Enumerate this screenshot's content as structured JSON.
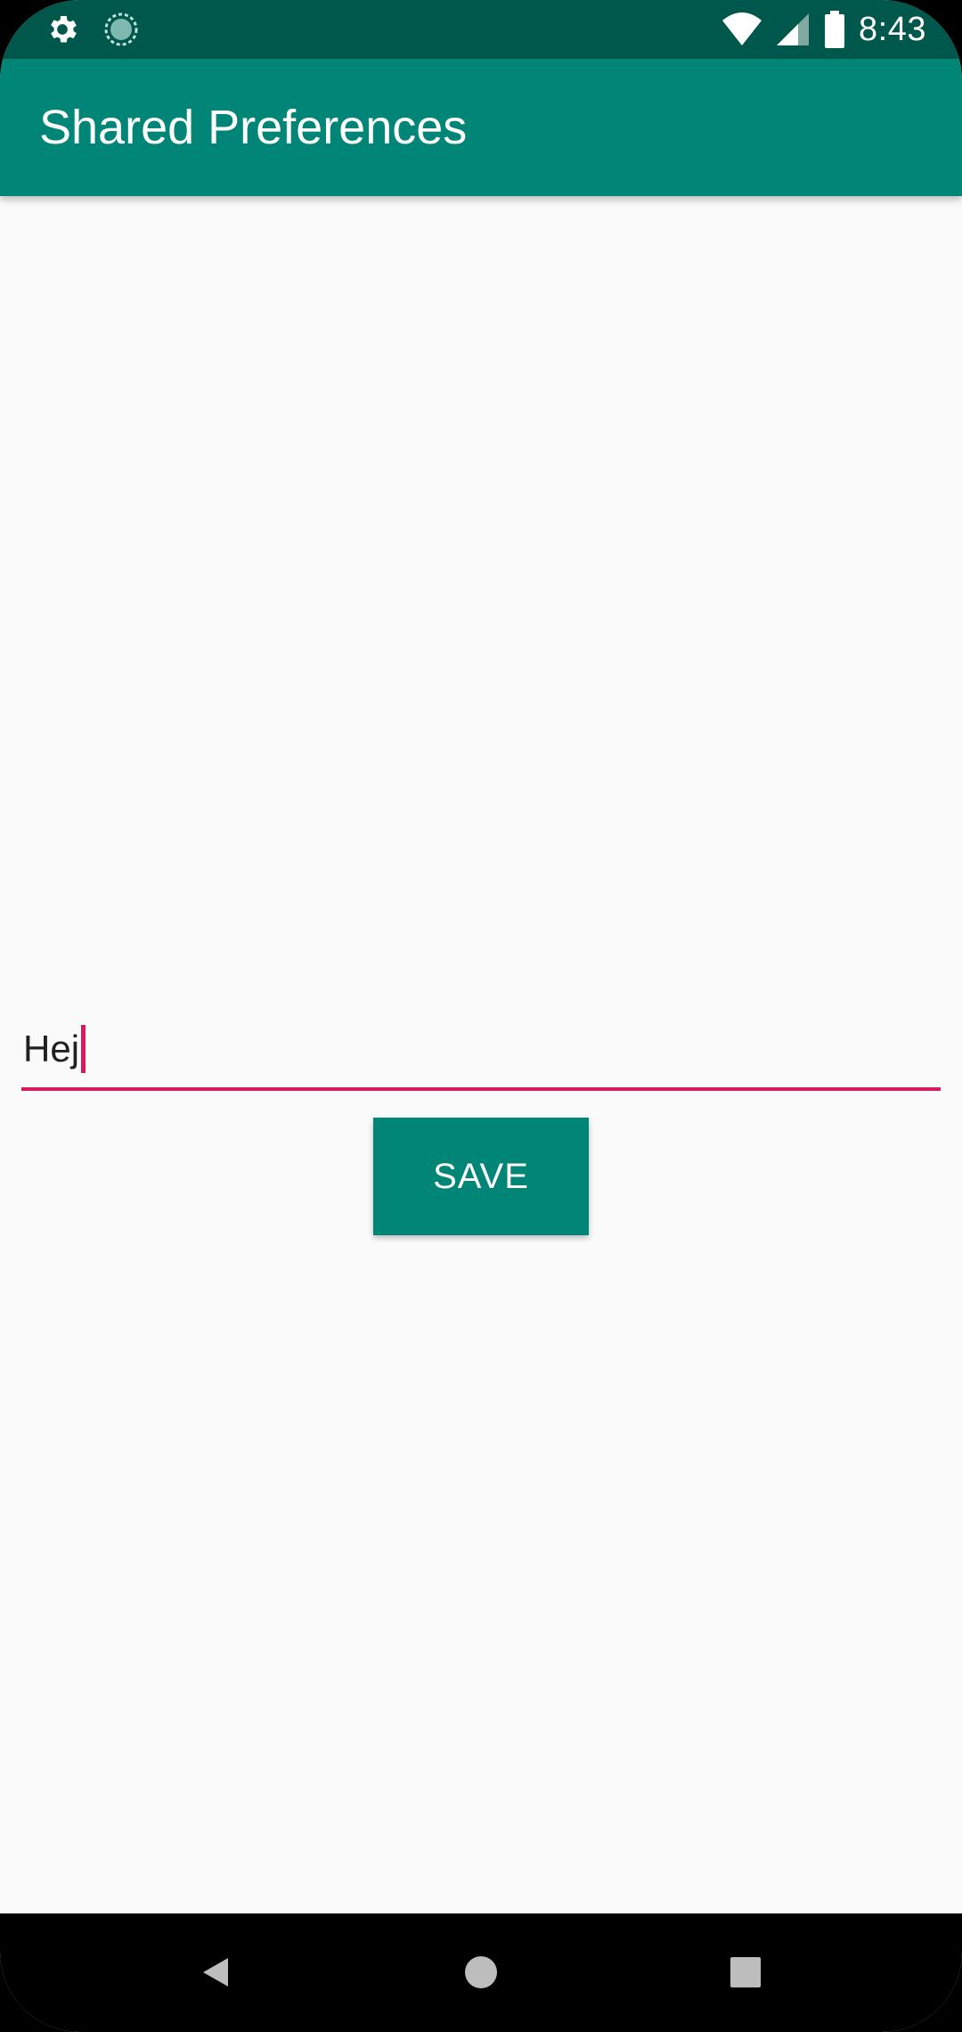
{
  "status_bar": {
    "time": "8:43",
    "icons": [
      "gear-icon",
      "sync-icon",
      "wifi-icon",
      "signal-icon",
      "battery-icon"
    ]
  },
  "app_bar": {
    "title": "Shared Preferences"
  },
  "main": {
    "text_field": {
      "value": "Hej"
    },
    "save_button": {
      "label": "SAVE"
    }
  },
  "nav_bar": {
    "buttons": [
      "back-icon",
      "home-icon",
      "recents-icon"
    ]
  },
  "colors": {
    "status_bar": "#00574b",
    "primary": "#008577",
    "accent": "#d81b60",
    "background": "#fafafa"
  }
}
